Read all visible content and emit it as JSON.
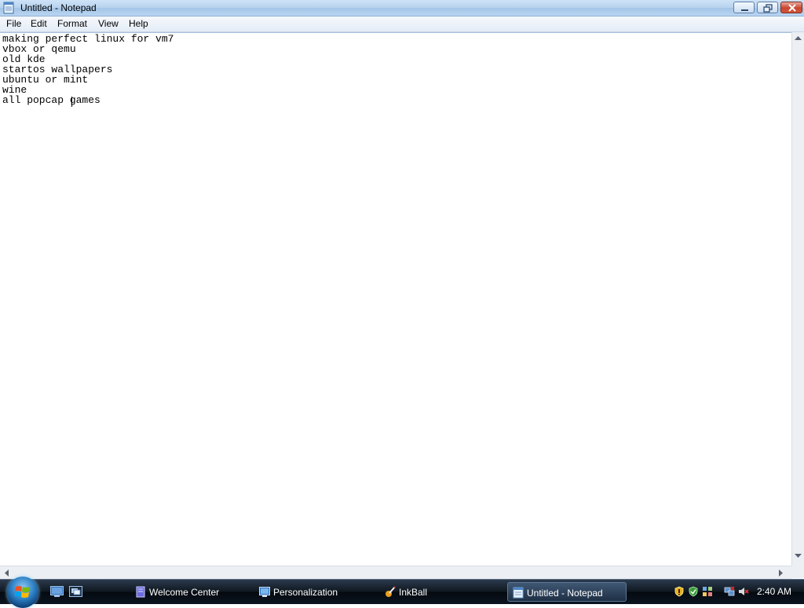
{
  "window": {
    "title": "Untitled - Notepad"
  },
  "menu": {
    "items": [
      "File",
      "Edit",
      "Format",
      "View",
      "Help"
    ]
  },
  "editor": {
    "lines": [
      "making perfect linux for vm7",
      "vbox or qemu",
      "old kde",
      "startos wallpapers",
      "ubuntu or mint",
      "wine",
      "all popcap games"
    ]
  },
  "taskbar": {
    "buttons": [
      {
        "label": "Welcome Center",
        "icon": "welcome-center-icon"
      },
      {
        "label": "Personalization",
        "icon": "personalization-icon"
      },
      {
        "label": "InkBall",
        "icon": "inkball-icon"
      },
      {
        "label": "Untitled - Notepad",
        "icon": "notepad-icon",
        "active": true
      }
    ],
    "clock": "2:40 AM"
  },
  "colors": {
    "titlebar": "#b6d2ee",
    "close_button": "#c8472f",
    "taskbar": "#101820",
    "start_orb": "#2c7fc4"
  }
}
